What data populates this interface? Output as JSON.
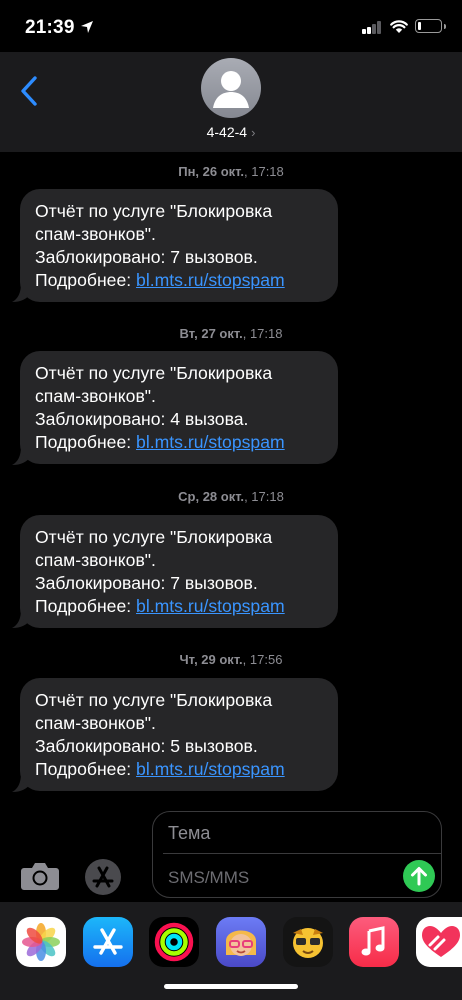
{
  "status_bar": {
    "time": "21:39",
    "battery_level": 0.15
  },
  "header": {
    "contact": "4-42-4",
    "chevron": "›"
  },
  "messages": [
    {
      "date_day": "Пн, 26 окт.",
      "date_time": "17:18",
      "lines": [
        "Отчёт по услуге \"Блокировка",
        "спам-звонков\".",
        "Заблокировано: 7 вызовов."
      ],
      "more_label": "Подробнее:",
      "link": "bl.mts.ru/stopspam"
    },
    {
      "date_day": "Вт, 27 окт.",
      "date_time": "17:18",
      "lines": [
        "Отчёт по услуге \"Блокировка",
        "спам-звонков\".",
        "Заблокировано: 4 вызова."
      ],
      "more_label": "Подробнее:",
      "link": "bl.mts.ru/stopspam"
    },
    {
      "date_day": "Ср, 28 окт.",
      "date_time": "17:18",
      "lines": [
        "Отчёт по услуге \"Блокировка",
        "спам-звонков\".",
        "Заблокировано: 7 вызовов."
      ],
      "more_label": "Подробнее:",
      "link": "bl.mts.ru/stopspam"
    },
    {
      "date_day": "Чт, 29 окт.",
      "date_time": "17:56",
      "lines": [
        "Отчёт по услуге \"Блокировка",
        "спам-звонков\".",
        "Заблокировано: 5 вызовов."
      ],
      "more_label": "Подробнее:",
      "link": "bl.mts.ru/stopspam"
    }
  ],
  "composer": {
    "subject_placeholder": "Тема",
    "message_placeholder": "SMS/MMS"
  },
  "app_drawer": [
    "photos-icon",
    "app-store-icon",
    "activity-icon",
    "memoji-icon",
    "animoji-icon",
    "music-icon",
    "digital-touch-icon"
  ],
  "colors": {
    "link": "#3a95ff",
    "bubble": "#262628",
    "send": "#2fc955",
    "back": "#2d8cff"
  }
}
